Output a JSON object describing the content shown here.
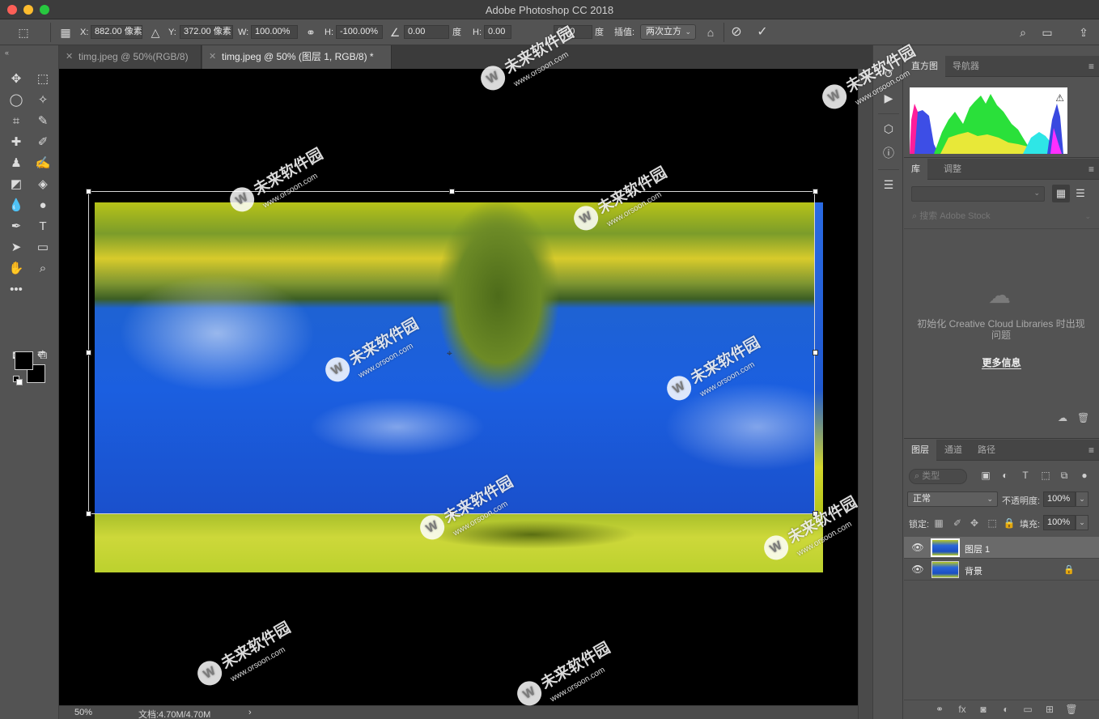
{
  "window": {
    "title": "Adobe Photoshop CC 2018"
  },
  "options": {
    "x_label": "X:",
    "x_value": "882.00 像素",
    "y_label": "Y:",
    "y_value": "372.00 像素",
    "w_label": "W:",
    "w_value": "100.00%",
    "h_label": "H:",
    "h_value": "-100.00%",
    "angle_value": "0.00",
    "angle_unit": "度",
    "skew_h_label": "H:",
    "skew_h_value": "0.00",
    "skew_v_value": "0.00",
    "skew_v_unit": "度",
    "interp_label": "插值:",
    "interp_value": "两次立方"
  },
  "tabs": [
    {
      "label": "timg.jpeg @ 50%(RGB/8)",
      "active": false
    },
    {
      "label": "timg.jpeg @ 50% (图层 1, RGB/8) *",
      "active": true
    }
  ],
  "status": {
    "zoom": "50%",
    "doc": "文档:4.70M/4.70M",
    "arrow": "›"
  },
  "histogram_panel": {
    "tabs": [
      "直方图",
      "导航器"
    ]
  },
  "library_panel": {
    "tabs": [
      "库",
      "调整"
    ],
    "search_placeholder": "搜索 Adobe Stock",
    "message": "初始化 Creative Cloud Libraries 时出现问题",
    "link": "更多信息"
  },
  "layers_panel": {
    "tabs": [
      "图层",
      "通道",
      "路径"
    ],
    "filter_placeholder": "类型",
    "blend_mode": "正常",
    "opacity_label": "不透明度:",
    "opacity_value": "100%",
    "lock_label": "锁定:",
    "fill_label": "填充:",
    "fill_value": "100%",
    "layers": [
      {
        "name": "图层 1",
        "selected": true,
        "locked": false
      },
      {
        "name": "背景",
        "selected": false,
        "locked": true
      }
    ]
  },
  "watermark": {
    "brand": "未来软件园",
    "url": "www.orsoon.com"
  }
}
